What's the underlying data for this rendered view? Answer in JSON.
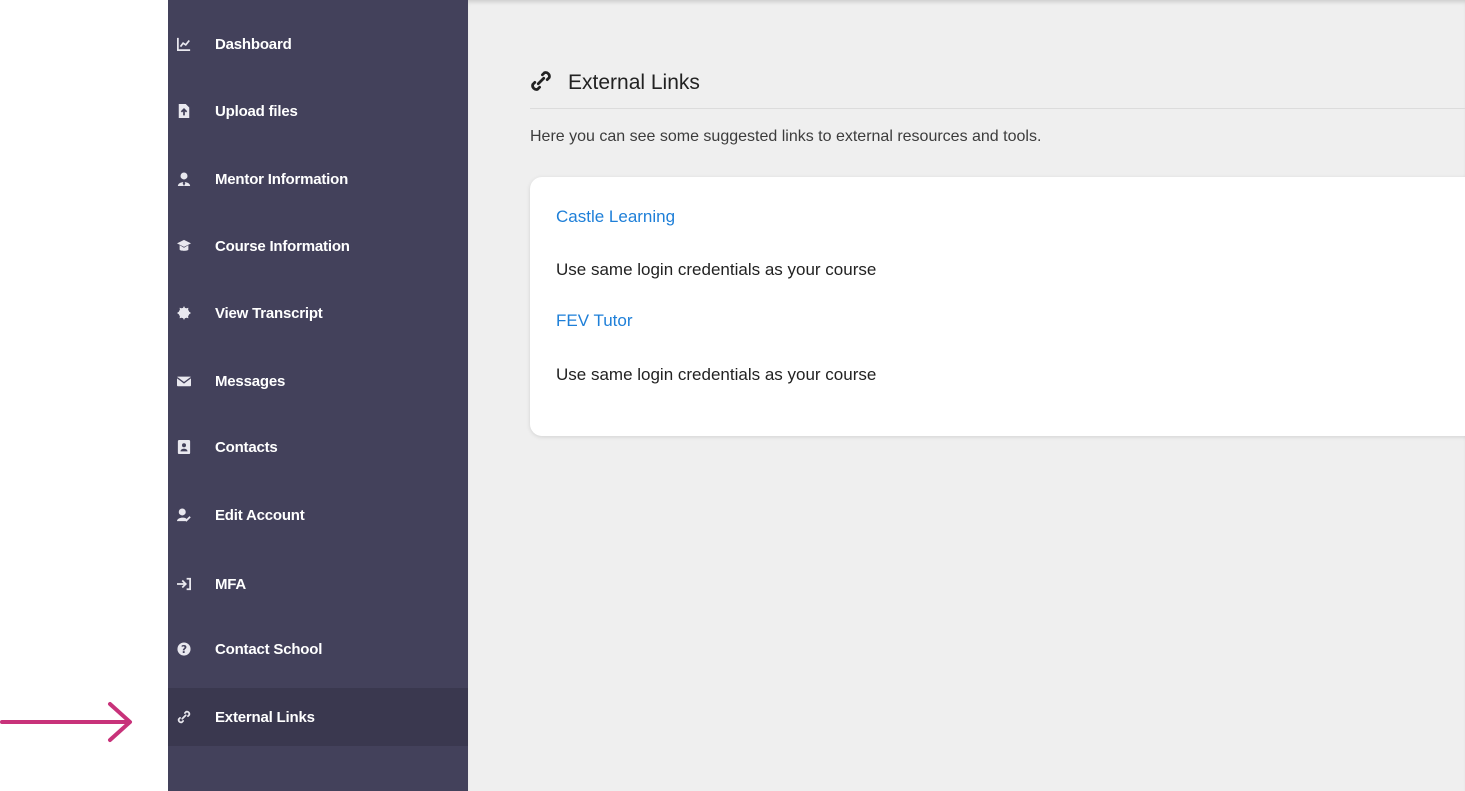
{
  "sidebar": {
    "items": [
      {
        "label": "Dashboard",
        "icon": "chart-line-icon",
        "active": false
      },
      {
        "label": "Upload files",
        "icon": "file-upload-icon",
        "active": false
      },
      {
        "label": "Mentor Information",
        "icon": "user-tie-icon",
        "active": false
      },
      {
        "label": "Course Information",
        "icon": "graduation-cap-icon",
        "active": false
      },
      {
        "label": "View Transcript",
        "icon": "certificate-icon",
        "active": false
      },
      {
        "label": "Messages",
        "icon": "envelope-icon",
        "active": false
      },
      {
        "label": "Contacts",
        "icon": "address-book-icon",
        "active": false
      },
      {
        "label": "Edit Account",
        "icon": "user-edit-icon",
        "active": false
      },
      {
        "label": "MFA",
        "icon": "sign-in-icon",
        "active": false
      },
      {
        "label": "Contact School",
        "icon": "question-circle-icon",
        "active": false
      },
      {
        "label": "External Links",
        "icon": "link-icon",
        "active": true
      }
    ]
  },
  "main": {
    "title": "External Links",
    "title_icon": "link-icon",
    "description": "Here you can see some suggested links to external resources and tools.",
    "links": [
      {
        "label": "Castle Learning",
        "description": "Use same login credentials as your course"
      },
      {
        "label": "FEV Tutor",
        "description": "Use same login credentials as your course"
      }
    ]
  },
  "colors": {
    "sidebar_bg": "#43415b",
    "sidebar_active_bg": "#3a384f",
    "main_bg": "#efefef",
    "link": "#1e7fd8",
    "annotation_arrow": "#c8327a"
  }
}
